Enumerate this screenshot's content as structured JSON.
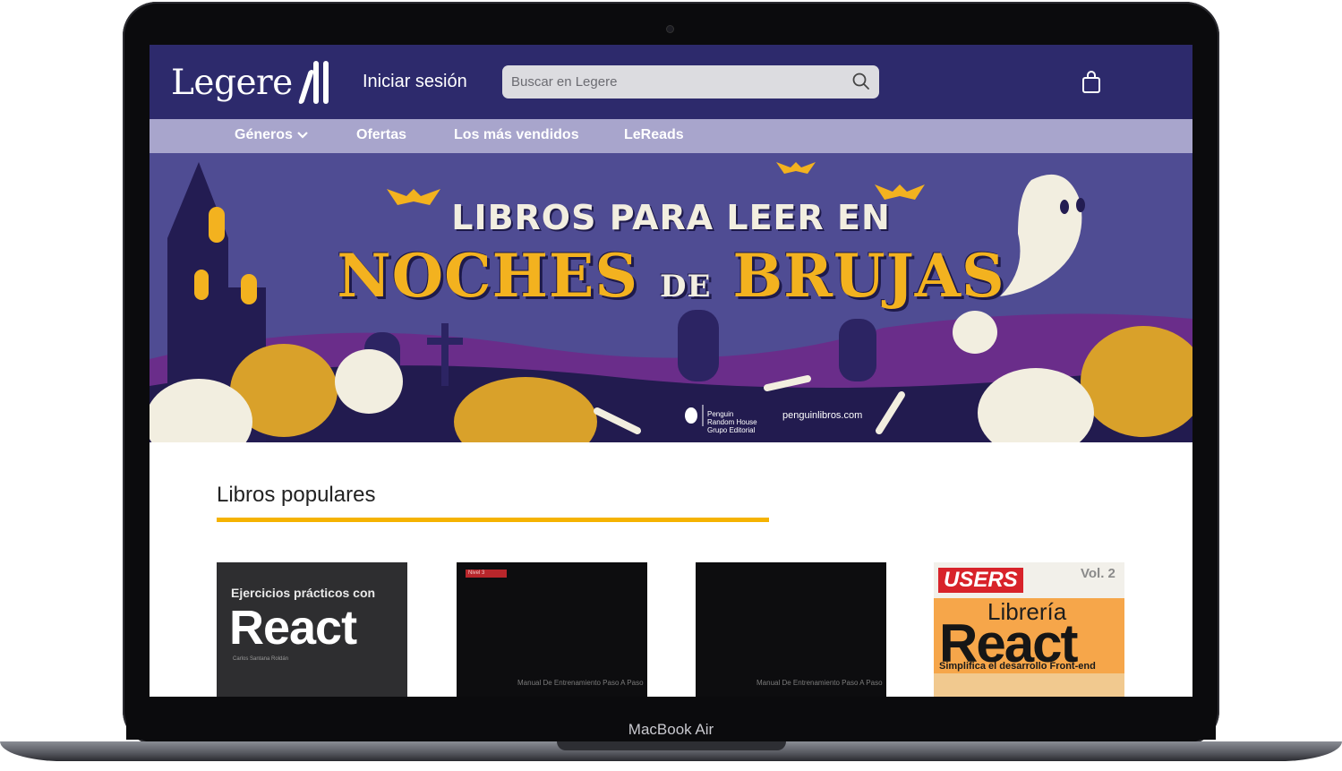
{
  "device": {
    "label": "MacBook Air"
  },
  "header": {
    "logo_text": "Legere",
    "login_label": "Iniciar sesión",
    "search_placeholder": "Buscar en Legere",
    "cart_icon": "shopping-bag-icon"
  },
  "nav": {
    "items": [
      {
        "label": "Géneros",
        "has_dropdown": true
      },
      {
        "label": "Ofertas"
      },
      {
        "label": "Los más vendidos"
      },
      {
        "label": "LeReads"
      }
    ]
  },
  "banner": {
    "line1": "LIBROS PARA LEER EN",
    "line2a": "NOCHES",
    "line2b": "DE",
    "line2c": "BRUJAS",
    "publisher": "Penguin Random House Grupo Editorial",
    "url": "penguinlibros.com"
  },
  "popular": {
    "title": "Libros populares",
    "books": [
      {
        "kicker": "Ejercicios prácticos con",
        "title": "React",
        "author": "Carlos Santana Roldán"
      },
      {
        "tag": "Nivel 3",
        "subtitle": "Manual De Entrenamiento Paso A Paso"
      },
      {
        "subtitle": "Manual De Entrenamiento Paso A Paso"
      },
      {
        "brand": "USERS",
        "volume": "Vol. 2",
        "line1": "Librería",
        "title": "React",
        "tagline": "Simplifica el desarrollo Front-end"
      }
    ]
  },
  "colors": {
    "header_bg": "#2d2a6c",
    "nav_bg": "#a8a5cc",
    "accent": "#f5b301"
  }
}
